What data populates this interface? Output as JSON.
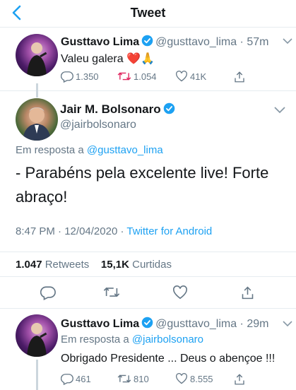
{
  "header": {
    "title": "Tweet"
  },
  "tweet_top": {
    "name": "Gusttavo Lima",
    "handle": "@gusttavo_lima",
    "time": "57m",
    "text": "Valeu galera",
    "emoji": "❤️🙏",
    "replies": "1.350",
    "retweets": "1.054",
    "likes": "41K"
  },
  "main_tweet": {
    "name": "Jair M. Bolsonaro",
    "handle": "@jairbolsonaro",
    "reply_prefix": "Em resposta a",
    "reply_handle": "@gusttavo_lima",
    "text": "- Parabéns pela excelente live! Forte abraço!",
    "time": "8:47 PM",
    "date": "12/04/2020",
    "source": "Twitter for Android",
    "retweet_count": "1.047",
    "retweet_label": "Retweets",
    "like_count": "15,1K",
    "like_label": "Curtidas"
  },
  "reply_tweet": {
    "name": "Gusttavo Lima",
    "handle": "@gusttavo_lima",
    "time": "29m",
    "reply_prefix": "Em resposta a",
    "reply_handle": "@jairbolsonaro",
    "text": "Obrigado Presidente ... Deus o abençoe !!!",
    "replies": "461",
    "retweets": "810",
    "likes": "8.555"
  },
  "colors": {
    "accent": "#1da1f2",
    "muted": "#657786",
    "like_red": "#e0245e"
  }
}
